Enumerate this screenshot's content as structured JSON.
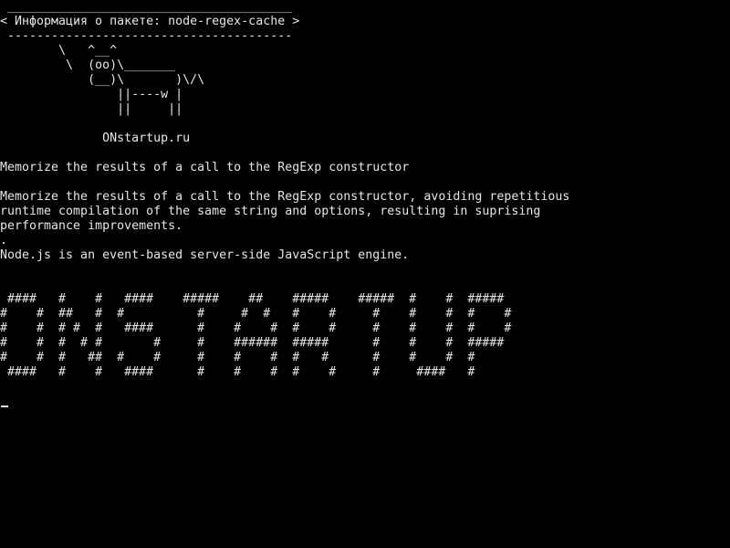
{
  "terminal": {
    "lines": [
      " _______________________________________",
      "< Информация о пакете: node-regex-cache >",
      " ---------------------------------------",
      "        \\   ^__^",
      "         \\  (oo)\\_______",
      "            (__)\\       )\\/\\",
      "                ||----w |",
      "                ||     ||",
      "",
      "              ONstartup.ru",
      "",
      "Memorize the results of a call to the RegExp constructor",
      "",
      "Memorize the results of a call to the RegExp constructor, avoiding repetitious",
      "runtime compilation of the same string and options, resulting in suprising",
      "performance improvements.",
      ".",
      "Node.js is an event-based server-side JavaScript engine.",
      "",
      "",
      " ####   #    #   ####    #####    ##    #####    #####  #    #  #####",
      "#    #  ##   #  #          #     #  #   #    #     #    #    #  #    #",
      "#    #  # #  #   ####      #    #    #  #    #     #    #    #  #    #",
      "#    #  #  # #       #     #    ######  #####      #    #    #  #####",
      "#    #  #   ##  #    #     #    #    #  #   #      #    #    #  #",
      " ####   #    #   ####      #    #    #  #    #     #     ####   #"
    ]
  }
}
